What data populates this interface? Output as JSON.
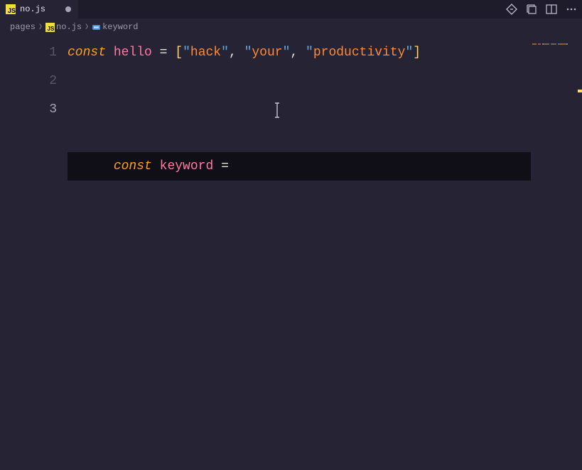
{
  "tab": {
    "filename": "no.js"
  },
  "breadcrumb": {
    "folder": "pages",
    "file": "no.js",
    "symbol": "keyword"
  },
  "lineNumbers": [
    "1",
    "2",
    "3"
  ],
  "code": {
    "line1": {
      "kw": "const",
      "ident": "hello",
      "eq": "=",
      "lb": "[",
      "q": "\"",
      "s1": "hack",
      "s2": "your",
      "s3": "productivity",
      "comma": ",",
      "rb": "]"
    },
    "line3": {
      "kw": "const",
      "ident": "keyword",
      "eq": "="
    }
  }
}
